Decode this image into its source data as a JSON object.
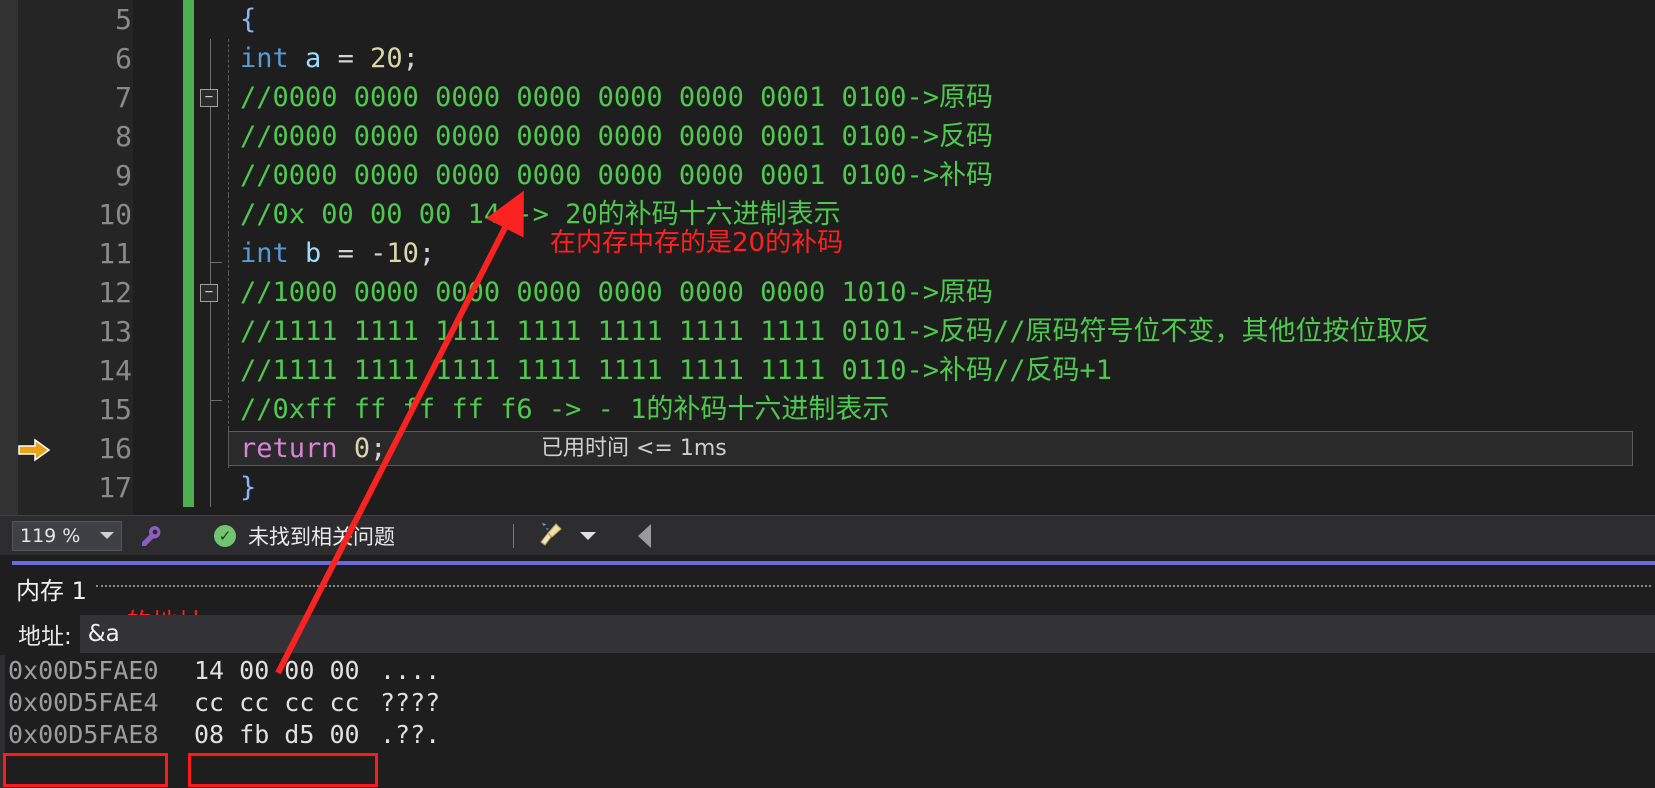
{
  "editor": {
    "zoom_label": "119 %",
    "lines": [
      {
        "num": "5",
        "tokens": [
          {
            "t": "brace",
            "v": "{"
          }
        ]
      },
      {
        "num": "6",
        "tokens": [
          {
            "t": "kw",
            "v": "int"
          },
          {
            "t": "plain",
            "v": " "
          },
          {
            "t": "id",
            "v": "a"
          },
          {
            "t": "plain",
            "v": " "
          },
          {
            "t": "op",
            "v": "="
          },
          {
            "t": "plain",
            "v": " "
          },
          {
            "t": "num",
            "v": "20"
          },
          {
            "t": "pun",
            "v": ";"
          }
        ]
      },
      {
        "num": "7",
        "tokens": [
          {
            "t": "cm",
            "v": "//0000 0000 0000 0000 0000 0000 0001 0100->原码"
          }
        ]
      },
      {
        "num": "8",
        "tokens": [
          {
            "t": "cm",
            "v": "//0000 0000 0000 0000 0000 0000 0001 0100->反码"
          }
        ]
      },
      {
        "num": "9",
        "tokens": [
          {
            "t": "cm",
            "v": "//0000 0000 0000 0000 0000 0000 0001 0100->补码"
          }
        ]
      },
      {
        "num": "10",
        "tokens": [
          {
            "t": "cm",
            "v": "//0x 00 00 00 14 -> 20的补码十六进制表示"
          }
        ]
      },
      {
        "num": "11",
        "tokens": [
          {
            "t": "kw",
            "v": "int"
          },
          {
            "t": "plain",
            "v": " "
          },
          {
            "t": "id",
            "v": "b"
          },
          {
            "t": "plain",
            "v": " "
          },
          {
            "t": "op",
            "v": "="
          },
          {
            "t": "plain",
            "v": " "
          },
          {
            "t": "op",
            "v": "-"
          },
          {
            "t": "num",
            "v": "10"
          },
          {
            "t": "pun",
            "v": ";"
          }
        ]
      },
      {
        "num": "12",
        "tokens": [
          {
            "t": "cm",
            "v": "//1000 0000 0000 0000 0000 0000 0000 1010->原码"
          }
        ]
      },
      {
        "num": "13",
        "tokens": [
          {
            "t": "cm",
            "v": "//1111 1111 1111 1111 1111 1111 1111 0101->反码//原码符号位不变，其他位按位取反"
          }
        ]
      },
      {
        "num": "14",
        "tokens": [
          {
            "t": "cm",
            "v": "//1111 1111 1111 1111 1111 1111 1111 0110->补码//反码+1"
          }
        ]
      },
      {
        "num": "15",
        "tokens": [
          {
            "t": "cm",
            "v": "//0xff ff ff ff f6 -> - 1的补码十六进制表示"
          }
        ]
      },
      {
        "num": "16",
        "tokens": [
          {
            "t": "ret",
            "v": "return"
          },
          {
            "t": "plain",
            "v": " "
          },
          {
            "t": "num",
            "v": "0"
          },
          {
            "t": "pun",
            "v": ";"
          }
        ]
      },
      {
        "num": "17",
        "tokens": [
          {
            "t": "brace",
            "v": "}"
          }
        ]
      }
    ],
    "datatip": "已用时间 <= 1ms",
    "collapse_glyph": "−"
  },
  "statusbar": {
    "zoom": "119 %",
    "wrench_icon": "wrench-icon",
    "status_icon": "check-circle-icon",
    "status_text": "未找到相关问题",
    "broom_icon": "broom-icon",
    "collapse_icon": "collapse-left-icon"
  },
  "memory": {
    "tab_label": "内存 1",
    "address_label": "地址:",
    "address_value": "&a",
    "address_placeholder": "",
    "annotation": "a的地址",
    "rows": [
      {
        "addr": "0x00D5FAE0",
        "hex": "14 00 00 00",
        "ascii": "...."
      },
      {
        "addr": "0x00D5FAE4",
        "hex": "cc cc cc cc",
        "ascii": "????"
      },
      {
        "addr": "0x00D5FAE8",
        "hex": "08 fb d5 00",
        "ascii": ".??."
      }
    ]
  },
  "annotations": {
    "code_note": "在内存中存的是20的补码",
    "accent_red": "#ff2020",
    "arrow_color": "#fb2222"
  }
}
